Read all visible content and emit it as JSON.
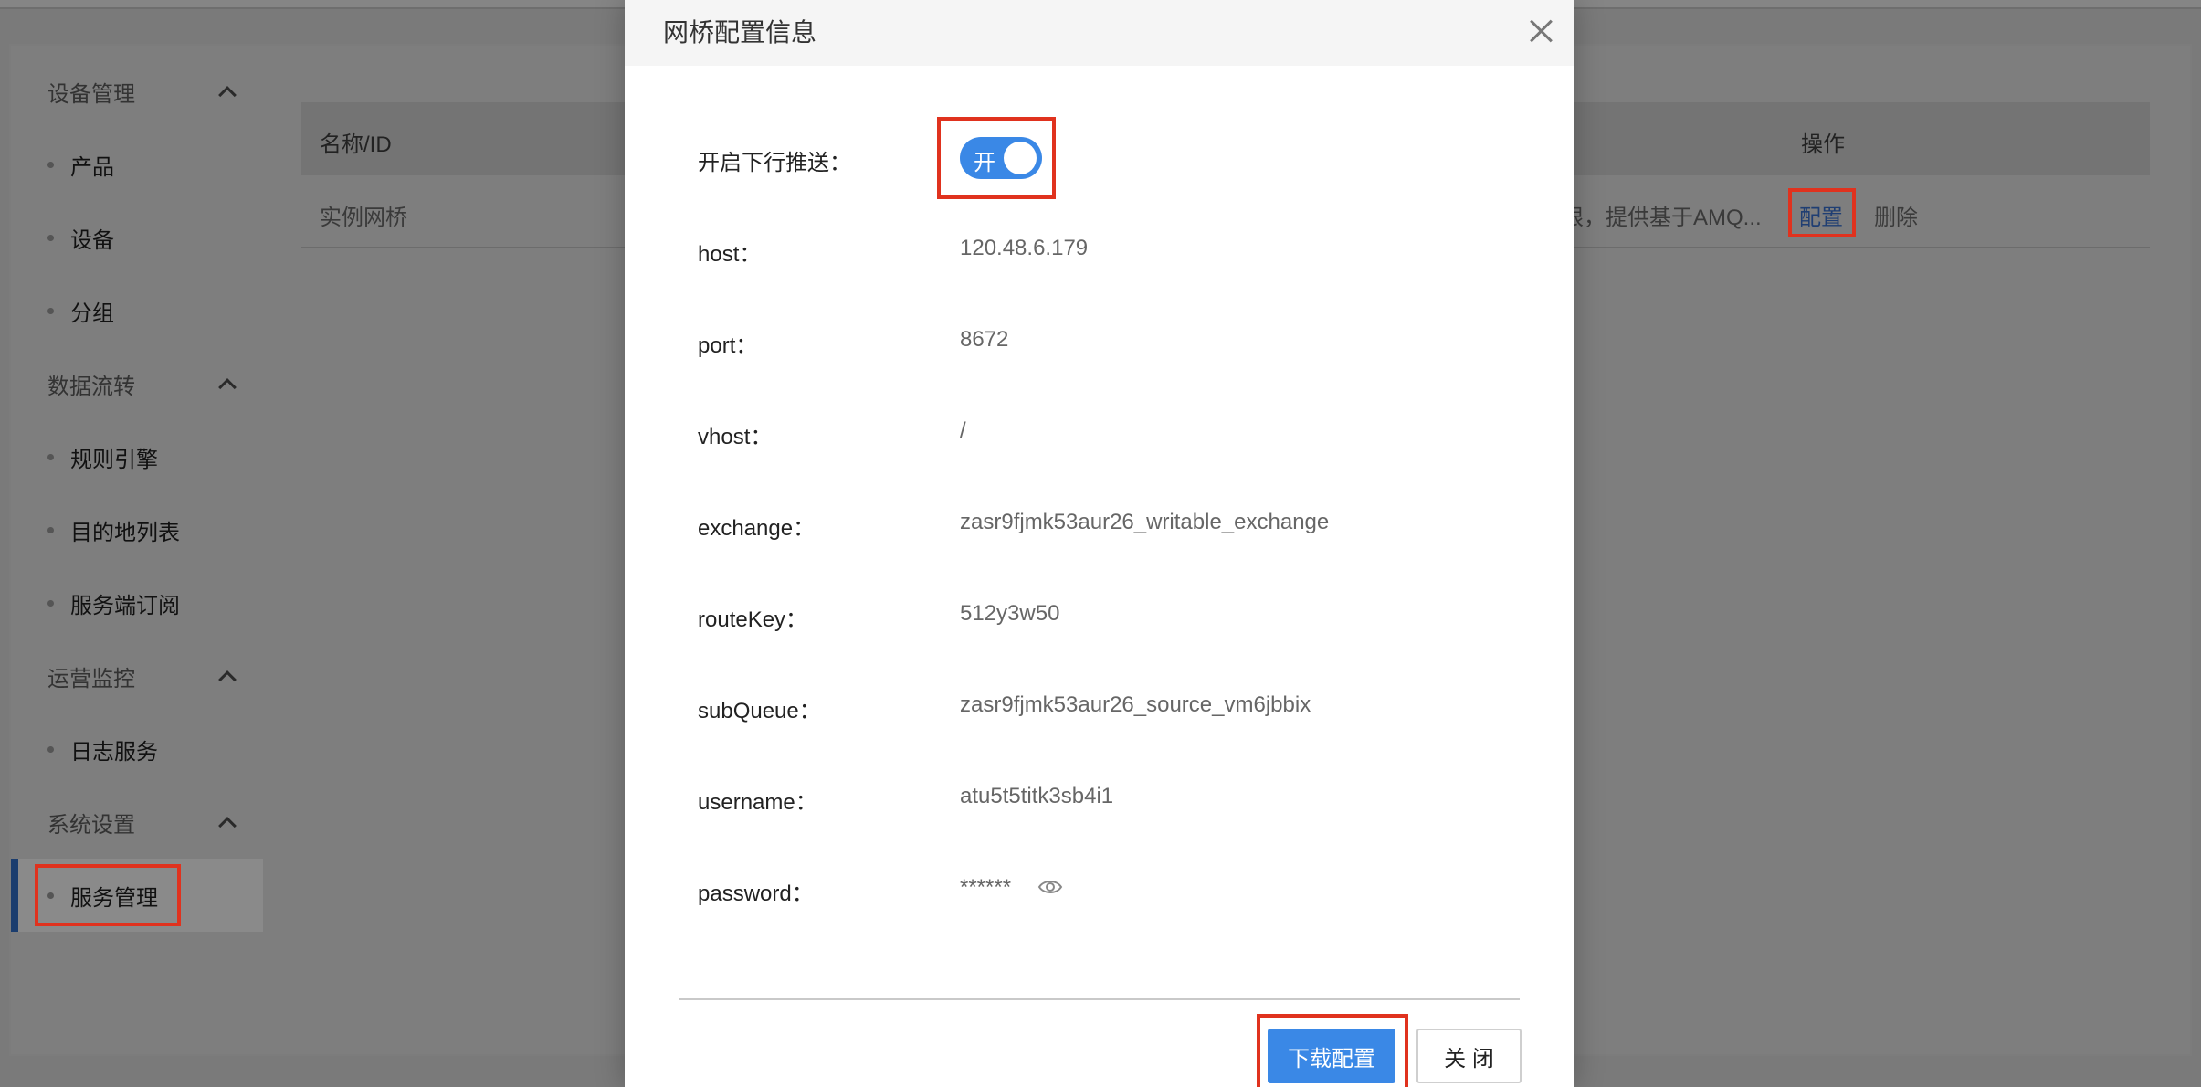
{
  "sidebar": {
    "groups": [
      {
        "title": "设备管理",
        "items": [
          "产品",
          "设备",
          "分组"
        ]
      },
      {
        "title": "数据流转",
        "items": [
          "规则引擎",
          "目的地列表",
          "服务端订阅"
        ]
      },
      {
        "title": "运营监控",
        "items": [
          "日志服务"
        ]
      },
      {
        "title": "系统设置",
        "items": [
          "服务管理"
        ]
      }
    ]
  },
  "table": {
    "headers": {
      "name": "名称/ID",
      "ops": "操作"
    },
    "row": {
      "name": "实例网桥",
      "desc": "限，提供基于AMQ...",
      "config": "配置",
      "delete": "删除"
    }
  },
  "modal": {
    "title": "网桥配置信息",
    "switch_label": "开启下行推送：",
    "switch_text": "开",
    "fields": [
      {
        "label": "host：",
        "value": "120.48.6.179"
      },
      {
        "label": "port：",
        "value": "8672"
      },
      {
        "label": "vhost：",
        "value": "/"
      },
      {
        "label": "exchange：",
        "value": "zasr9fjmk53aur26_writable_exchange"
      },
      {
        "label": "routeKey：",
        "value": "512y3w50"
      },
      {
        "label": "subQueue：",
        "value": "zasr9fjmk53aur26_source_vm6jbbix"
      },
      {
        "label": "username：",
        "value": "atu5t5titk3sb4i1"
      },
      {
        "label": "password：",
        "value": "******"
      }
    ],
    "download_label": "下载配置",
    "close_label": "关 闭"
  },
  "colors": {
    "accent": "#3a88e6",
    "highlight": "#e0321e",
    "active_bar": "#1b3d6e"
  }
}
